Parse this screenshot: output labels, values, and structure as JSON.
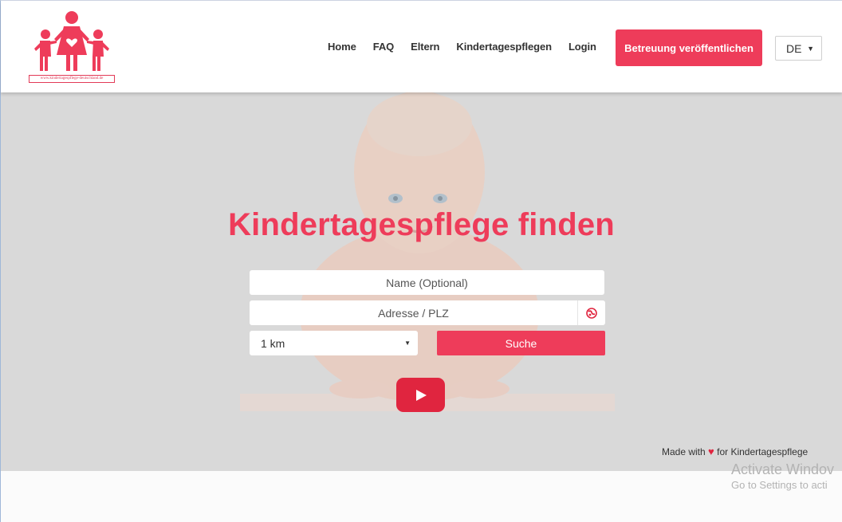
{
  "header": {
    "logo_caption": "www.kindertagespflege-deutschland.de",
    "nav": [
      "Home",
      "FAQ",
      "Eltern",
      "Kindertagespflegen",
      "Login"
    ],
    "cta_label": "Betreuung veröffentlichen",
    "language": "DE"
  },
  "hero": {
    "title": "Kindertagespflege finden",
    "name_placeholder": "Name (Optional)",
    "address_placeholder": "Adresse / PLZ",
    "radius_value": "1 km",
    "search_label": "Suche",
    "made_with_prefix": "Made with",
    "made_with_suffix": "for Kindertagespflege"
  },
  "watermark": {
    "line1": "Activate Windov",
    "line2": "Go to Settings to acti"
  },
  "colors": {
    "accent": "#ee3c5a",
    "hero_bg": "#d9d9d9",
    "play": "#e0253f"
  },
  "icons": [
    "logo-family-icon",
    "chevron-down-icon",
    "locate-icon",
    "play-icon",
    "heart-icon"
  ]
}
